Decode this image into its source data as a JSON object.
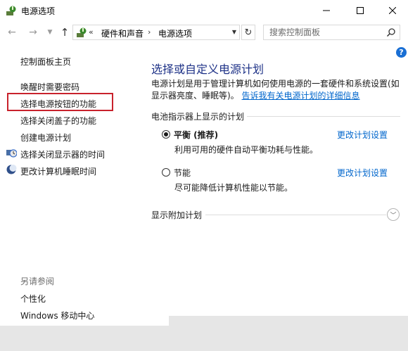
{
  "window": {
    "title": "电源选项",
    "icons": {
      "app": "power-options-icon",
      "minimize": "minimize-icon",
      "maximize": "maximize-icon",
      "close": "close-icon"
    }
  },
  "address": {
    "prefix": "«",
    "crumbs": [
      "硬件和声音",
      "电源选项"
    ],
    "separator": "›",
    "search_placeholder": "搜索控制面板"
  },
  "left_pane": {
    "home": "控制面板主页",
    "links": [
      "唤醒时需要密码",
      "选择电源按钮的功能",
      "选择关闭盖子的功能",
      "创建电源计划",
      "选择关闭显示器的时间",
      "更改计算机睡眠时间"
    ],
    "highlighted_index": 1,
    "see_also": "另请参阅",
    "see_also_links": [
      "个性化",
      "Windows 移动中心"
    ]
  },
  "main": {
    "title": "选择或自定义电源计划",
    "desc_text": "电源计划是用于管理计算机如何使用电源的一套硬件和系统设置(如显示器亮度、睡眠等)。",
    "desc_link": "告诉我有关电源计划的详细信息",
    "section_label": "电池指示器上显示的计划",
    "plans": [
      {
        "name": "平衡 (推荐)",
        "desc": "利用可用的硬件自动平衡功耗与性能。",
        "link": "更改计划设置",
        "selected": true
      },
      {
        "name": "节能",
        "desc": "尽可能降低计算机性能以节能。",
        "link": "更改计划设置",
        "selected": false
      }
    ],
    "more_plans": "显示附加计划"
  },
  "colors": {
    "title_blue": "#1e3287",
    "link_blue": "#0066cc",
    "highlight_red": "#c8222c",
    "help_blue": "#1a6fd4"
  }
}
